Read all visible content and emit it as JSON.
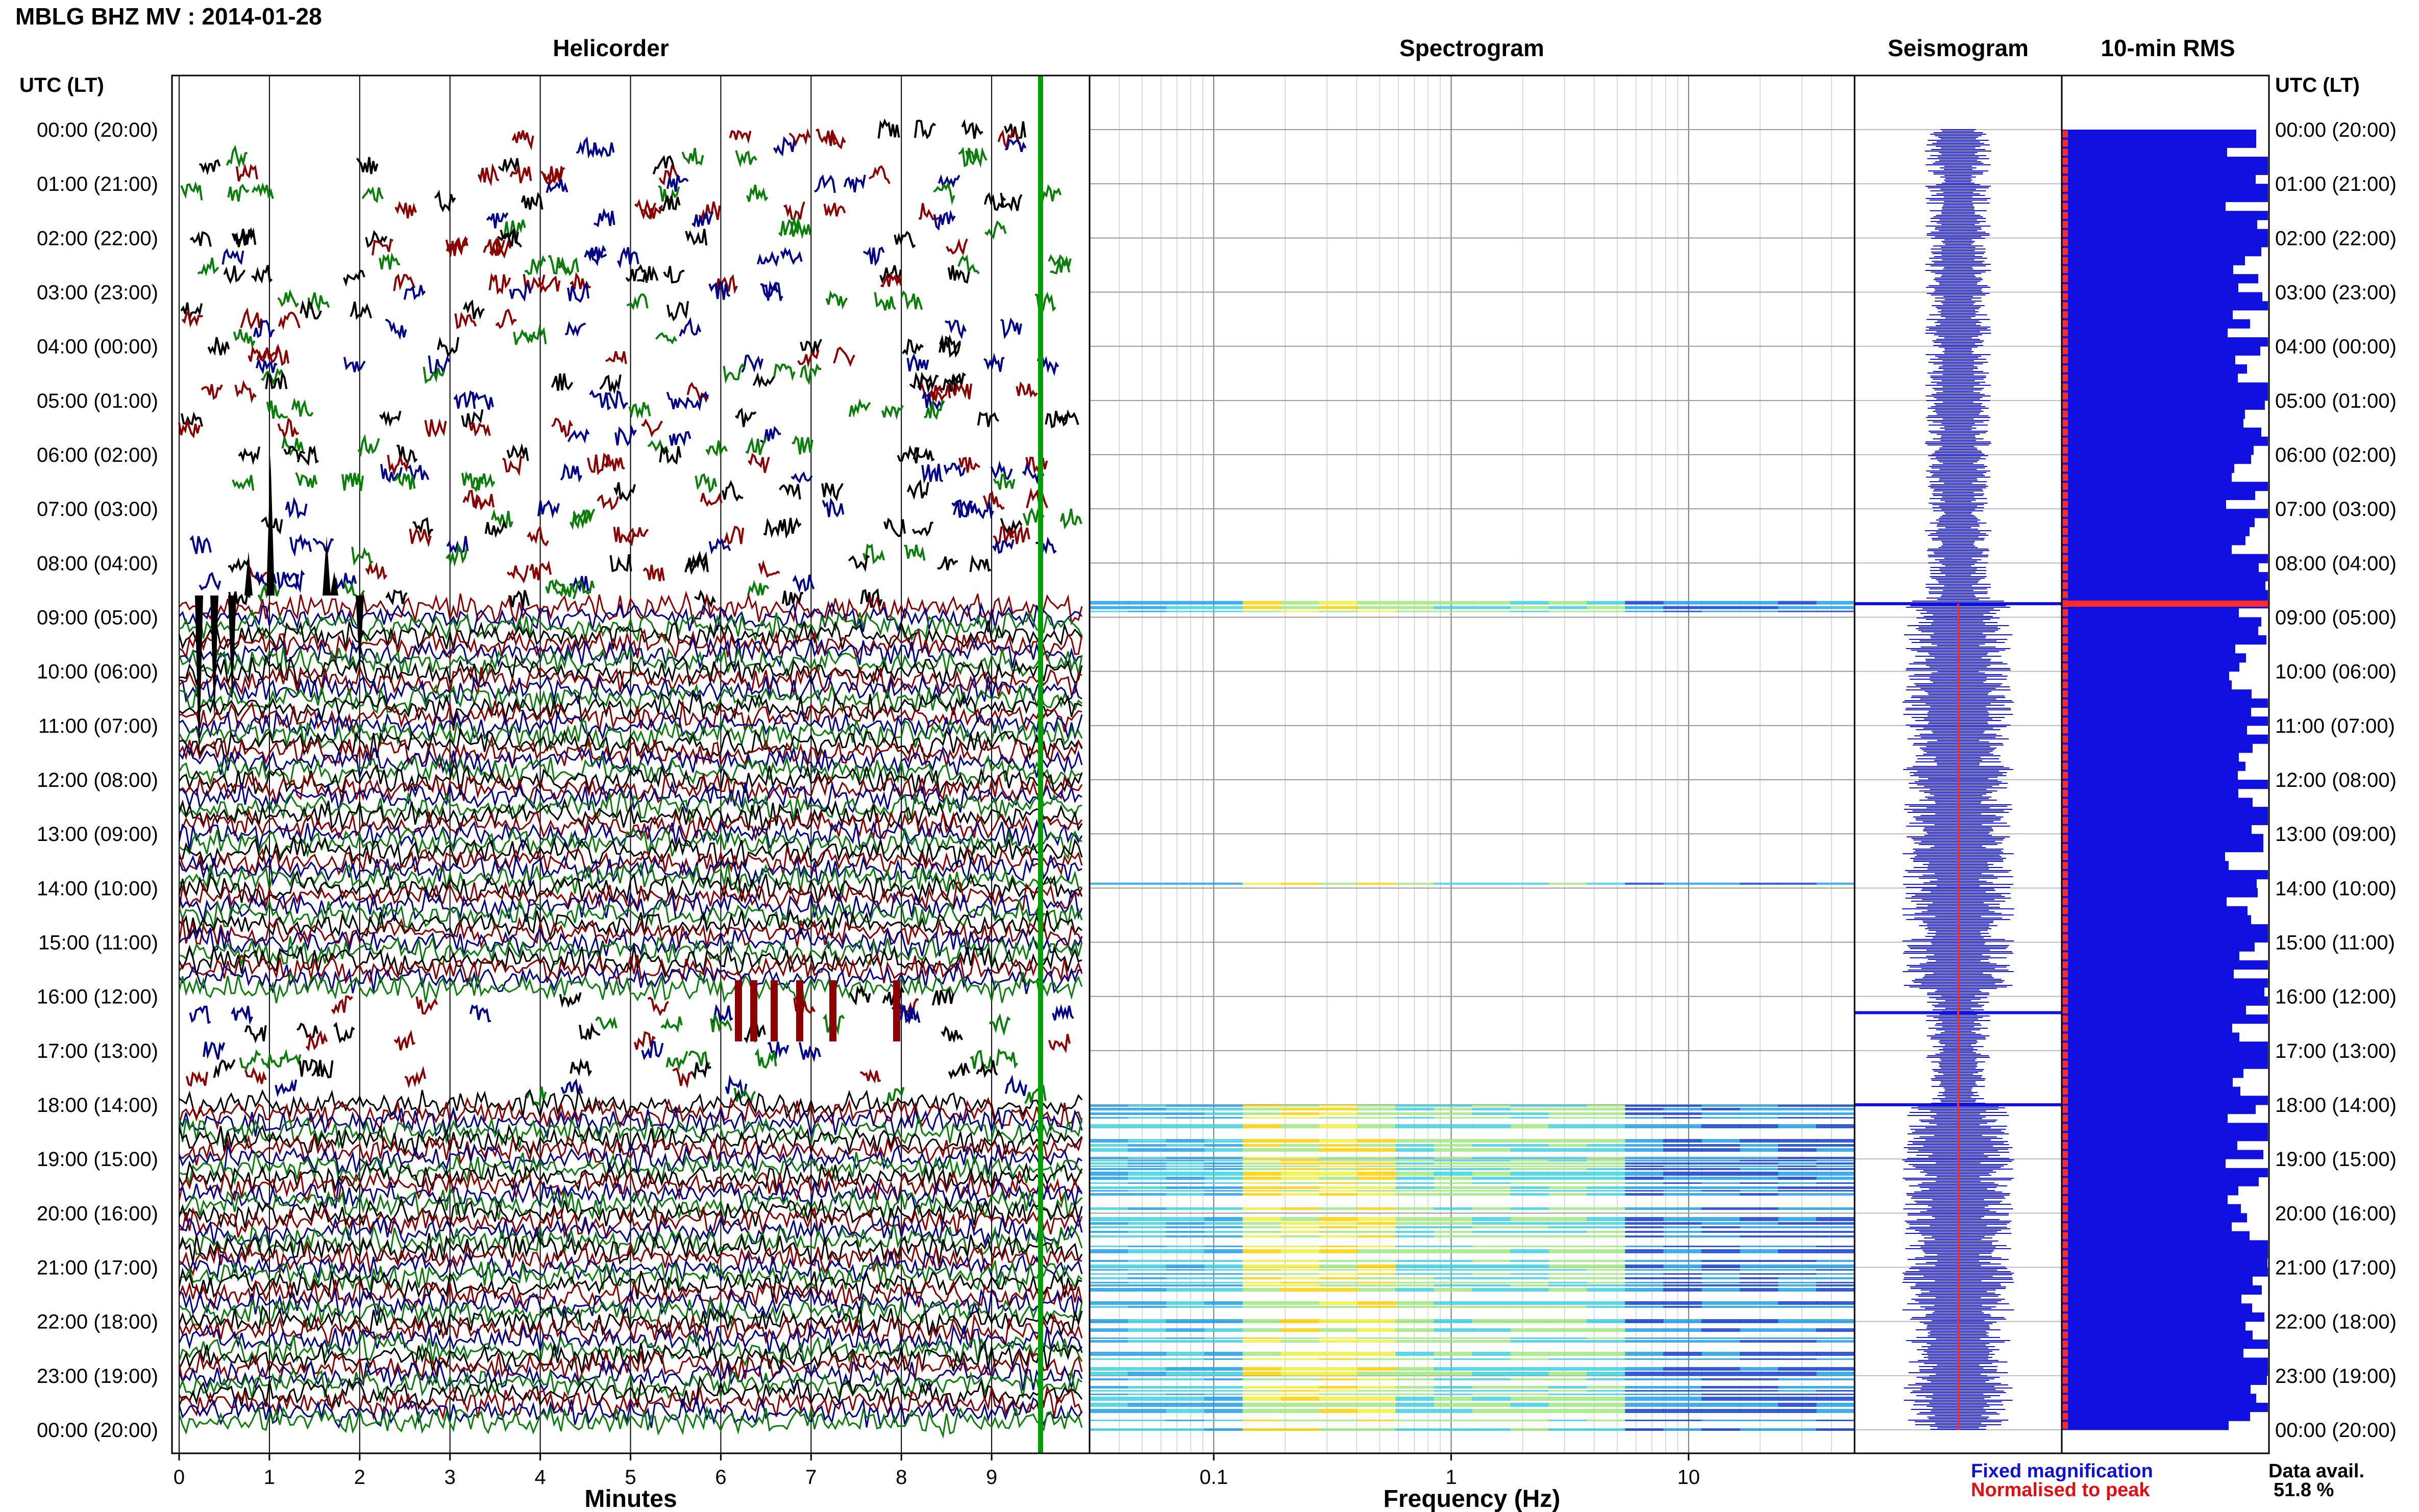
{
  "figure_title": "MBLG BHZ MV : 2014-01-28",
  "time_axis_header_left": "UTC (LT)",
  "time_axis_header_right": "UTC (LT)",
  "time_labels": [
    "00:00 (20:00)",
    "01:00 (21:00)",
    "02:00 (22:00)",
    "03:00 (23:00)",
    "04:00 (00:00)",
    "05:00 (01:00)",
    "06:00 (02:00)",
    "07:00 (03:00)",
    "08:00 (04:00)",
    "09:00 (05:00)",
    "10:00 (06:00)",
    "11:00 (07:00)",
    "12:00 (08:00)",
    "13:00 (09:00)",
    "14:00 (10:00)",
    "15:00 (11:00)",
    "16:00 (12:00)",
    "17:00 (13:00)",
    "18:00 (14:00)",
    "19:00 (15:00)",
    "20:00 (16:00)",
    "21:00 (17:00)",
    "22:00 (18:00)",
    "23:00 (19:00)",
    "00:00 (20:00)"
  ],
  "legend": {
    "fixed": "Fixed magnification",
    "normalised": "Normalised to peak",
    "fixed_color": "#1010d8",
    "normalised_color": "#e01010"
  },
  "data_avail_label": "Data avail.",
  "data_avail_value": "51.8 %",
  "colors": {
    "trace": [
      "#000000",
      "#8b0000",
      "#00008b",
      "#0b7d0b"
    ],
    "fixed_mag": "#1010e0",
    "normalised": "#ff2a2a",
    "highlight_green": "#00a000"
  },
  "chart_data": [
    {
      "type": "line",
      "title": "Helicorder",
      "xlabel": "Minutes",
      "ylabel": "",
      "xlim": [
        0,
        10
      ],
      "x_ticks": [
        "0",
        "1",
        "2",
        "3",
        "4",
        "5",
        "6",
        "7",
        "8",
        "9"
      ],
      "rows_per_hour": 6,
      "hours": 24,
      "quiet_noise_before_utc_hour": 8.7,
      "activity": [
        {
          "start_hour": 0.0,
          "end_hour": 8.7,
          "level": "sparse events"
        },
        {
          "start_hour": 8.7,
          "end_hour": 15.9,
          "level": "continuous tremor"
        },
        {
          "start_hour": 15.9,
          "end_hour": 18.0,
          "level": "sparse events"
        },
        {
          "start_hour": 18.0,
          "end_hour": 24.0,
          "level": "continuous tremor"
        }
      ]
    },
    {
      "type": "heatmap",
      "title": "Spectrogram",
      "xlabel": "Frequency (Hz)",
      "ylabel": "",
      "xscale": "log",
      "xlim": [
        0.03,
        50
      ],
      "x_ticks": [
        "0.1",
        "1",
        "10"
      ],
      "energy_bands": [
        {
          "start_hour": 8.7,
          "end_hour": 8.9
        },
        {
          "start_hour": 13.9,
          "end_hour": 14.0
        },
        {
          "start_hour": 18.0,
          "end_hour": 24.0
        }
      ],
      "peak_frequency_band_hz": [
        0.15,
        0.3
      ]
    },
    {
      "type": "line",
      "title": "Seismogram",
      "series": [
        {
          "name": "Fixed magnification"
        },
        {
          "name": "Normalised to peak"
        }
      ],
      "spikes_utc_hour": [
        8.75,
        16.3,
        18.0
      ]
    },
    {
      "type": "bar",
      "title": "10-min RMS",
      "orientation": "horizontal",
      "bins_per_hour": 6,
      "fixed_magnification_level": "near full scale in most bins",
      "normalised_peak_hour": 8.75
    }
  ]
}
